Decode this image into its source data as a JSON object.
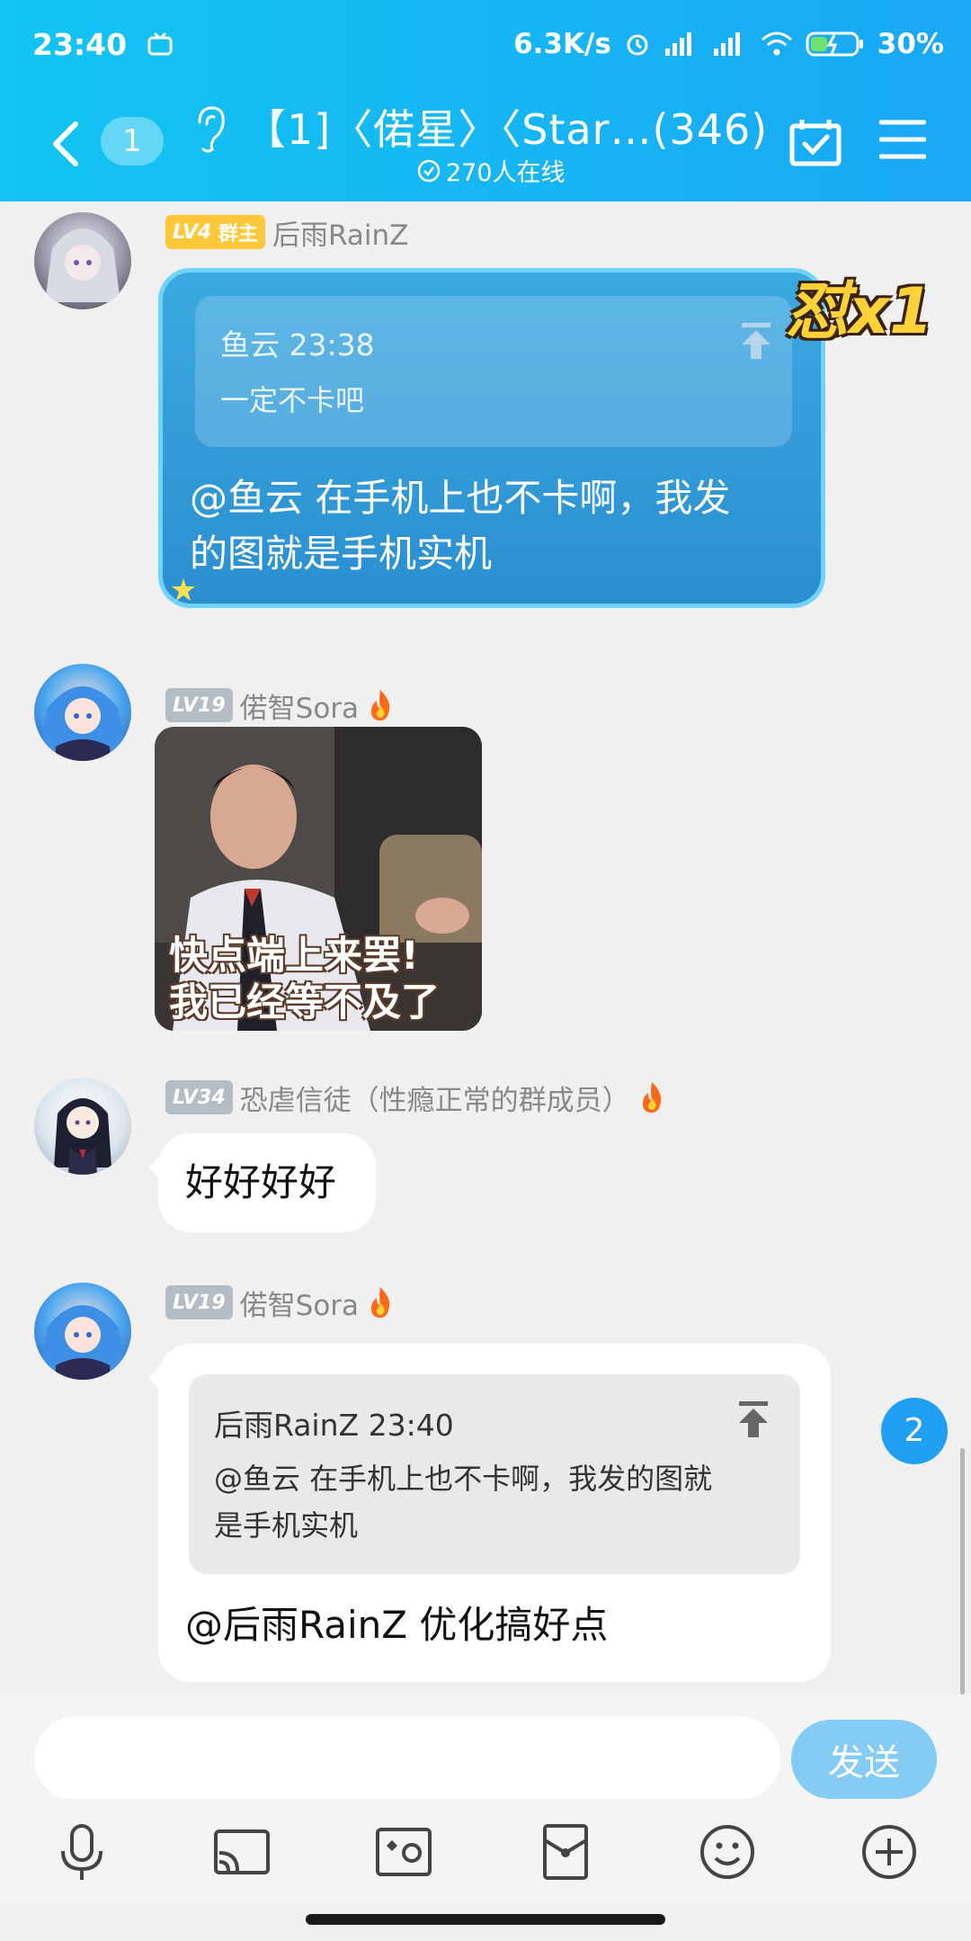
{
  "status_bar": {
    "time": "23:40",
    "net_speed": "6.3K/s",
    "battery": "30%"
  },
  "header": {
    "unread_count": "1",
    "title": "【1]〈偌星〉〈Star…(346)",
    "online": "270人在线"
  },
  "messages": [
    {
      "level": "LV4",
      "role": "群主",
      "name": "后雨RainZ",
      "quote_header": "鱼云 23:38",
      "quote_text": "一定不卡吧",
      "text_line1": "@鱼云 在手机上也不卡啊，我发",
      "text_line2": "的图就是手机实机",
      "badge": "怼x1"
    },
    {
      "level": "LV19",
      "name": "偌智Sora",
      "sticker_line1": "快点端上来罢!",
      "sticker_line2": "我已经等不及了"
    },
    {
      "level": "LV34",
      "name": "恐虐信徒（性瘾正常的群成员）",
      "text": "好好好好"
    },
    {
      "level": "LV19",
      "name": "偌智Sora",
      "quote_header": "后雨RainZ 23:40",
      "quote_line1": "@鱼云 在手机上也不卡啊，我发的图就",
      "quote_line2": "是手机实机",
      "text": "@后雨RainZ 优化搞好点"
    }
  ],
  "new_messages_count": "2",
  "input": {
    "placeholder": "",
    "send_label": "发送"
  },
  "toolbar": [
    "mic-icon",
    "screen-cast-icon",
    "photo-icon",
    "red-packet-icon",
    "emoji-icon",
    "plus-icon"
  ],
  "colors": {
    "header": "#12c5f2",
    "accent": "#1fa0f2",
    "send_button": "#84ccf5"
  }
}
